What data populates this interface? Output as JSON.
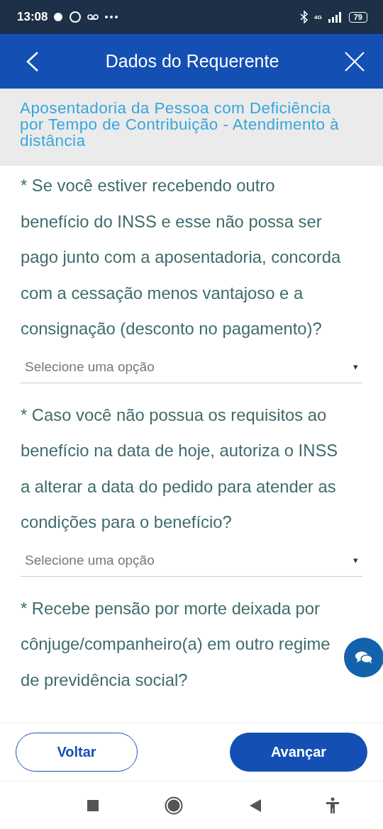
{
  "status_bar": {
    "time": "13:08",
    "battery": "79",
    "network": "4G"
  },
  "header": {
    "title": "Dados do Requerente"
  },
  "subtitle": "Aposentadoria da Pessoa com Deficiência por Tempo de Contribuição - Atendimento à distância",
  "questions": [
    {
      "text": "* Se você estiver recebendo outro benefício do INSS e esse não possa ser pago junto com a aposentadoria, concorda com a cessação menos vantajoso e a consignação (desconto no pagamento)?",
      "select": {
        "placeholder": "Selecione uma opção",
        "arrow": "▾"
      }
    },
    {
      "text": "* Caso você não possua os requisitos ao benefício na data de hoje, autoriza o INSS a alterar a data do pedido para atender as condições para o benefício?",
      "select": {
        "placeholder": "Selecione uma opção",
        "arrow": "▾"
      }
    },
    {
      "text": "* Recebe pensão por morte deixada por cônjuge/companheiro(a) em outro regime de previdência social?"
    }
  ],
  "buttons": [
    {
      "label": "Voltar",
      "kind": "outline"
    },
    {
      "label": "Avançar",
      "kind": "filled"
    }
  ]
}
